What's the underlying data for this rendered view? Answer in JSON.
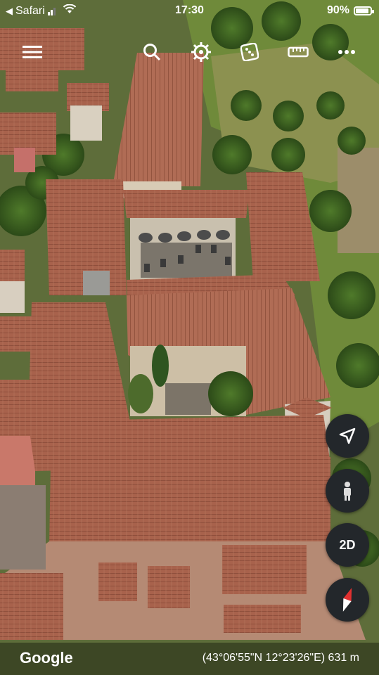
{
  "status_bar": {
    "carrier": "Safari",
    "time": "17:30",
    "battery_text": "90%",
    "battery_level": 0.9
  },
  "toolbar": {
    "icons": [
      "menu-icon",
      "search-icon",
      "voyager-icon",
      "dice-icon",
      "ruler-icon",
      "more-icon"
    ]
  },
  "controls": {
    "view_mode_label": "2D",
    "icons": [
      "navigation-arrow-icon",
      "pegman-icon",
      "compass-icon"
    ]
  },
  "footer": {
    "brand": "Google",
    "coordinates": "(43°06'55\"N 12°23'26\"E) 631 m"
  },
  "colors": {
    "roof": "#a8624c",
    "grass": "#6f8a3a",
    "fab_bg": "#23272b",
    "compass_red": "#e03030"
  }
}
